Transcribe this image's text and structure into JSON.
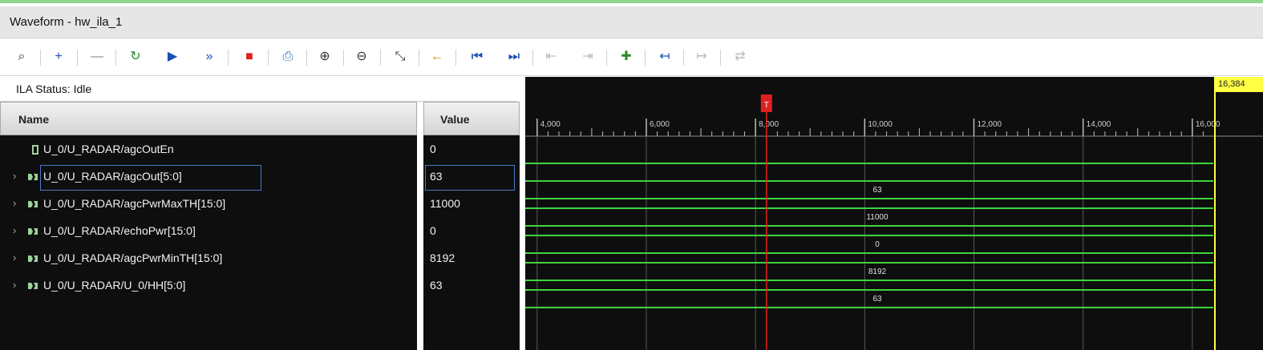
{
  "window": {
    "title": "Waveform - hw_ila_1"
  },
  "toolbar": {
    "buttons": [
      {
        "name": "search-icon",
        "glyph": "⌕",
        "color": "#333333",
        "dim": false
      },
      {
        "name": "add-icon",
        "glyph": "+",
        "color": "#1a4fb5",
        "dim": false
      },
      {
        "name": "remove-icon",
        "glyph": "—",
        "color": "#888888",
        "dim": true
      },
      {
        "name": "run-trigger-immediate-icon",
        "glyph": "↻",
        "color": "#2e8b2e",
        "dim": false
      },
      {
        "name": "run-trigger-icon",
        "glyph": "▶",
        "color": "#1a4fb5",
        "dim": false
      },
      {
        "name": "run-continuous-icon",
        "glyph": "»",
        "color": "#1a4fb5",
        "dim": false
      },
      {
        "name": "stop-icon",
        "glyph": "■",
        "color": "#e02020",
        "dim": false
      },
      {
        "name": "export-icon",
        "glyph": "⎙",
        "color": "#2e6fb5",
        "dim": false
      },
      {
        "name": "zoom-in-icon",
        "glyph": "⊕",
        "color": "#333333",
        "dim": false
      },
      {
        "name": "zoom-out-icon",
        "glyph": "⊖",
        "color": "#333333",
        "dim": false
      },
      {
        "name": "zoom-fit-icon",
        "glyph": "⤡",
        "color": "#333333",
        "dim": false
      },
      {
        "name": "go-to-cursor-icon",
        "glyph": "←",
        "color": "#d28a00",
        "dim": false
      },
      {
        "name": "go-to-start-icon",
        "glyph": "⏮",
        "color": "#1a4fb5",
        "dim": false
      },
      {
        "name": "go-to-end-icon",
        "glyph": "⏭",
        "color": "#1a4fb5",
        "dim": false
      },
      {
        "name": "previous-transition-icon",
        "glyph": "⇤",
        "color": "#bbbbbb",
        "dim": true
      },
      {
        "name": "next-transition-icon",
        "glyph": "⇥",
        "color": "#bbbbbb",
        "dim": true
      },
      {
        "name": "add-marker-icon",
        "glyph": "✚",
        "color": "#2e8b2e",
        "dim": false
      },
      {
        "name": "previous-marker-icon",
        "glyph": "↤",
        "color": "#1a4fb5",
        "dim": false
      },
      {
        "name": "next-marker-icon",
        "glyph": "↦",
        "color": "#bbbbbb",
        "dim": true
      },
      {
        "name": "swap-cursors-icon",
        "glyph": "⇄",
        "color": "#bbbbbb",
        "dim": true
      }
    ]
  },
  "ila_status": {
    "label": "ILA Status: Idle"
  },
  "columns": {
    "name": "Name",
    "value": "Value"
  },
  "signals": [
    {
      "name": "U_0/U_RADAR/agcOutEn",
      "value": "0",
      "expandable": false,
      "bus": false,
      "selected": false,
      "wave_label": ""
    },
    {
      "name": "U_0/U_RADAR/agcOut[5:0]",
      "value": "63",
      "expandable": true,
      "bus": true,
      "selected": true,
      "wave_label": "63"
    },
    {
      "name": "U_0/U_RADAR/agcPwrMaxTH[15:0]",
      "value": "11000",
      "expandable": true,
      "bus": true,
      "selected": false,
      "wave_label": "11000"
    },
    {
      "name": "U_0/U_RADAR/echoPwr[15:0]",
      "value": "0",
      "expandable": true,
      "bus": true,
      "selected": false,
      "wave_label": "0"
    },
    {
      "name": "U_0/U_RADAR/agcPwrMinTH[15:0]",
      "value": "8192",
      "expandable": true,
      "bus": true,
      "selected": false,
      "wave_label": "8192"
    },
    {
      "name": "U_0/U_RADAR/U_0/HH[5:0]",
      "value": "63",
      "expandable": true,
      "bus": true,
      "selected": false,
      "wave_label": "63"
    }
  ],
  "timeline": {
    "ticks": [
      "4,000",
      "6,000",
      "8,000",
      "10,000",
      "12,000",
      "14,000",
      "16,000"
    ],
    "marker_label": "16,384",
    "trigger_label": "T",
    "range": [
      3900,
      16384
    ],
    "trigger_at": 8200
  },
  "colors": {
    "wave": "#3fd43f",
    "trigger": "#e02020",
    "marker": "#ffff44",
    "background": "#0e0e0e"
  }
}
